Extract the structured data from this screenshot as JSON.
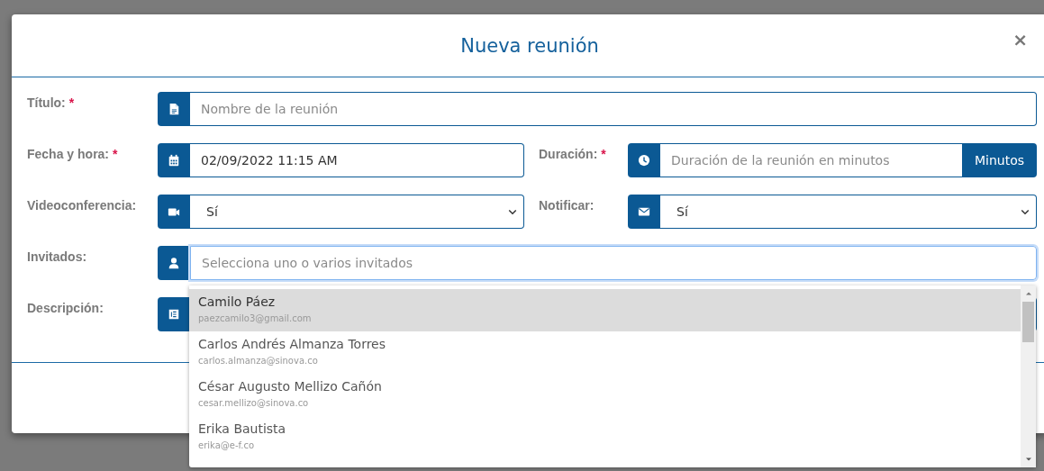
{
  "modal": {
    "title": "Nueva reunión",
    "close": "×"
  },
  "rows": [
    [
      {
        "label": "Título:",
        "required_mark": "*",
        "kind": "text",
        "placeholder": "Nombre de la reunión",
        "focused": false
      }
    ],
    [
      {
        "label": "Fecha y hora:",
        "required_mark": "*",
        "kind": "text",
        "value": "02/09/2022 11:15 AM",
        "focused": false
      },
      {
        "label": "Duración:",
        "required_mark": "*",
        "kind": "text",
        "placeholder": "Duración de la reunión en minutos",
        "suffix": "Minutos",
        "focused": false
      }
    ],
    [
      {
        "label": "Videoconferencia:",
        "kind": "select",
        "value": "Sí",
        "focused": false
      },
      {
        "label": "Notificar:",
        "kind": "select",
        "value": "Sí",
        "focused": false
      }
    ],
    [
      {
        "label": "Invitados:",
        "kind": "multiselect",
        "placeholder": "Selecciona uno o varios invitados",
        "focused": true,
        "options": [
          {
            "name": "Camilo Páez",
            "email": "paezcamilo3@gmail.com",
            "selected": true
          },
          {
            "name": "Carlos Andrés Almanza Torres",
            "email": "carlos.almanza@sinova.co",
            "selected": false
          },
          {
            "name": "César Augusto Mellizo Cañón",
            "email": "cesar.mellizo@sinova.co",
            "selected": false
          },
          {
            "name": "Erika Bautista",
            "email": "erika@e-f.co",
            "selected": false
          }
        ]
      }
    ],
    [
      {
        "label": "Descripción:",
        "kind": "textarea",
        "focused": false
      }
    ]
  ]
}
